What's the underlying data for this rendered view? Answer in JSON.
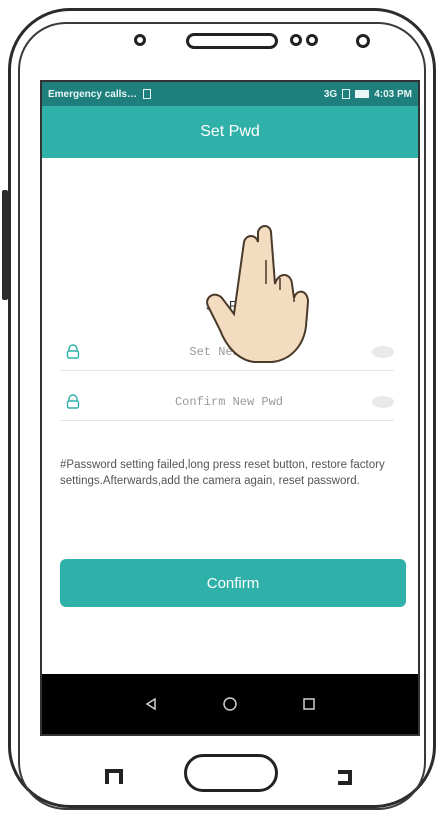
{
  "status_bar": {
    "left_text": "Emergency calls…",
    "right_text": "4:03 PM",
    "network": "3G"
  },
  "header": {
    "title": "Set Pwd"
  },
  "form": {
    "title": "Set Pwd",
    "new_password_placeholder": "Set New Pwd",
    "confirm_password_placeholder": "Confirm New Pwd",
    "note": "#Password setting failed,long press reset button, restore factory settings.Afterwards,add the camera again, reset password.",
    "confirm_label": "Confirm"
  },
  "colors": {
    "accent": "#2fb1a9",
    "status": "#1e7f7c",
    "nav_bar": "#000000"
  },
  "icons": [
    "lock-icon",
    "eye-icon",
    "back-icon",
    "home-icon",
    "recents-icon",
    "hand-pointer-icon"
  ]
}
